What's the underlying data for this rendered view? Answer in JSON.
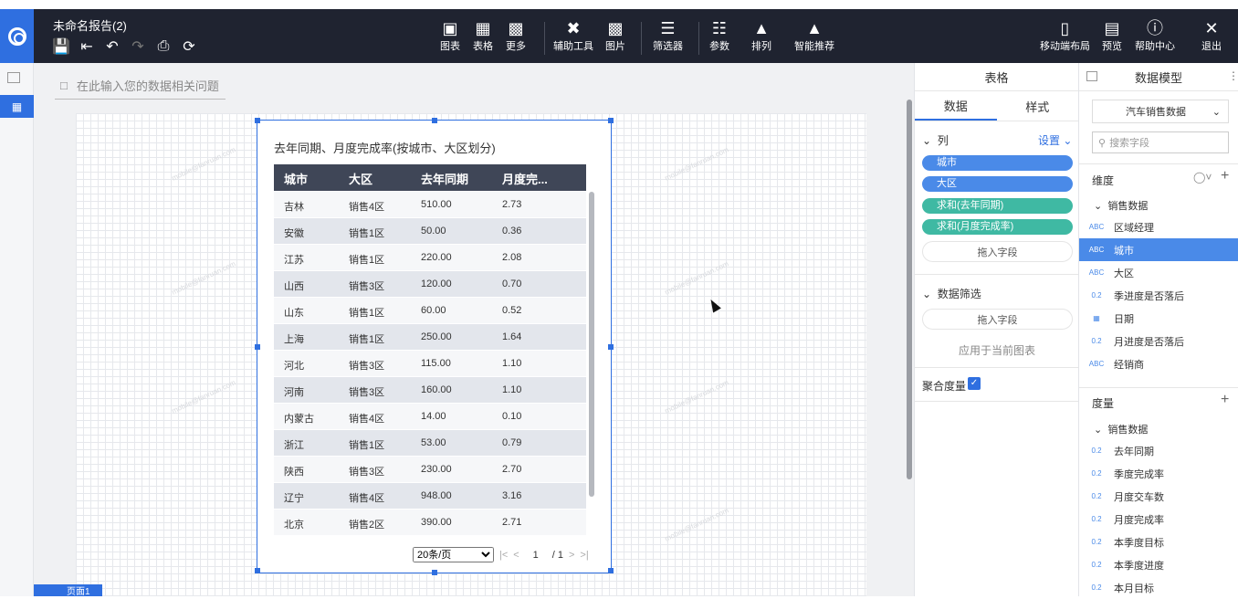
{
  "header": {
    "report_title": "未命名报告(2)",
    "tools": [
      {
        "icon": "bar-chart-icon",
        "label": "图表"
      },
      {
        "icon": "table-icon",
        "label": "表格"
      },
      {
        "icon": "more-grid-icon",
        "label": "更多"
      },
      {
        "icon": "tools-icon",
        "label": "辅助工具"
      },
      {
        "icon": "image-icon",
        "label": "图片"
      },
      {
        "icon": "filter-icon",
        "label": "筛选器"
      },
      {
        "icon": "params-icon",
        "label": "参数"
      },
      {
        "icon": "sort-icon",
        "label": "排列"
      },
      {
        "icon": "smart-icon",
        "label": "智能推荐"
      }
    ],
    "right_tools": [
      {
        "icon": "mobile-icon",
        "label": "移动端布局"
      },
      {
        "icon": "preview-icon",
        "label": "预览"
      },
      {
        "icon": "help-icon",
        "label": "帮助中心"
      },
      {
        "icon": "close-icon",
        "label": "退出"
      }
    ]
  },
  "canvas": {
    "ask_placeholder": "在此输入您的数据相关问题"
  },
  "widget": {
    "title": "去年同期、月度完成率(按城市、大区划分)",
    "columns": [
      "城市",
      "大区",
      "去年同期",
      "月度完..."
    ],
    "rows": [
      [
        "吉林",
        "销售4区",
        "510.00",
        "2.73"
      ],
      [
        "安徽",
        "销售1区",
        "50.00",
        "0.36"
      ],
      [
        "江苏",
        "销售1区",
        "220.00",
        "2.08"
      ],
      [
        "山西",
        "销售3区",
        "120.00",
        "0.70"
      ],
      [
        "山东",
        "销售1区",
        "60.00",
        "0.52"
      ],
      [
        "上海",
        "销售1区",
        "250.00",
        "1.64"
      ],
      [
        "河北",
        "销售3区",
        "115.00",
        "1.10"
      ],
      [
        "河南",
        "销售3区",
        "160.00",
        "1.10"
      ],
      [
        "内蒙古",
        "销售4区",
        "14.00",
        "0.10"
      ],
      [
        "浙江",
        "销售1区",
        "53.00",
        "0.79"
      ],
      [
        "陕西",
        "销售3区",
        "230.00",
        "2.70"
      ],
      [
        "辽宁",
        "销售4区",
        "948.00",
        "3.16"
      ],
      [
        "北京",
        "销售2区",
        "390.00",
        "2.71"
      ]
    ],
    "page_size": "20条/页",
    "page_current": "1",
    "page_total": "/ 1"
  },
  "panel_table": {
    "title": "表格",
    "tab_data": "数据",
    "tab_style": "样式",
    "columns_label": "列",
    "settings_label": "设置",
    "column_fields": [
      {
        "label": "城市",
        "type": "blue"
      },
      {
        "label": "大区",
        "type": "blue"
      },
      {
        "label": "求和(去年同期)",
        "type": "green"
      },
      {
        "label": "求和(月度完成率)",
        "type": "green"
      }
    ],
    "drop_field": "拖入字段",
    "filter_label": "数据筛选",
    "filter_drop": "拖入字段",
    "apply_label": "应用于当前图表",
    "aggregate_label": "聚合度量"
  },
  "panel_model": {
    "title": "数据模型",
    "dataset": "汽车销售数据",
    "search_placeholder": "搜索字段",
    "dimension_label": "维度",
    "dimension_group": "销售数据",
    "dimensions": [
      {
        "icon": "ABC",
        "label": "区域经理"
      },
      {
        "icon": "ABC",
        "label": "城市"
      },
      {
        "icon": "ABC",
        "label": "大区"
      },
      {
        "icon": "0.2",
        "label": "季进度是否落后"
      },
      {
        "icon": "date",
        "label": "日期"
      },
      {
        "icon": "0.2",
        "label": "月进度是否落后"
      },
      {
        "icon": "ABC",
        "label": "经销商"
      }
    ],
    "measure_label": "度量",
    "measure_group": "销售数据",
    "measures": [
      {
        "icon": "0.2",
        "label": "去年同期"
      },
      {
        "icon": "0.2",
        "label": "季度完成率"
      },
      {
        "icon": "0.2",
        "label": "月度交车数"
      },
      {
        "icon": "0.2",
        "label": "月度完成率"
      },
      {
        "icon": "0.2",
        "label": "本季度目标"
      },
      {
        "icon": "0.2",
        "label": "本季度进度"
      },
      {
        "icon": "0.2",
        "label": "本月目标"
      }
    ]
  },
  "footer": {
    "page_tab": "页面1"
  },
  "colors": {
    "accent": "#2f6fe0",
    "header_bg": "#1f2330",
    "pill_blue": "#4a8ae8",
    "pill_green": "#3fb9a3"
  }
}
